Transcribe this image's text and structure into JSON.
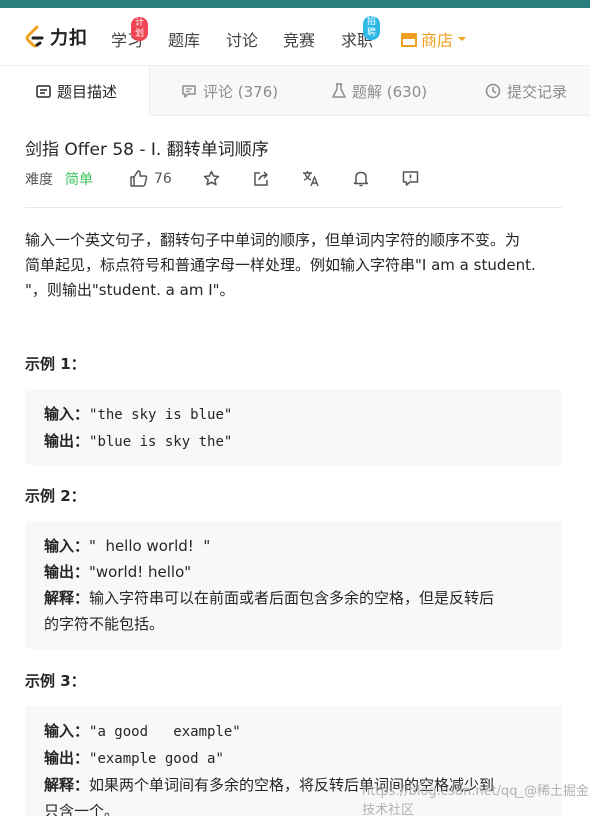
{
  "nav": {
    "logo_text": "力扣",
    "items": [
      {
        "label": "学习",
        "badge": "计划"
      },
      {
        "label": "题库"
      },
      {
        "label": "讨论"
      },
      {
        "label": "竞赛"
      },
      {
        "label": "求职",
        "badge": "招聘"
      },
      {
        "label": "商店"
      }
    ],
    "store_color": "#f0a020"
  },
  "tabs": [
    {
      "label": "题目描述",
      "icon": "description-icon",
      "active": true
    },
    {
      "label": "评论 (376)",
      "icon": "comment-icon"
    },
    {
      "label": "题解 (630)",
      "icon": "flask-icon"
    },
    {
      "label": "提交记录",
      "icon": "clock-icon"
    }
  ],
  "problem": {
    "title": "剑指 Offer 58 - I. 翻转单词顺序",
    "difficulty_label": "难度",
    "difficulty": "简单",
    "difficulty_color": "#3ec35d",
    "likes": "76",
    "description_lines": [
      "输入一个英文句子，翻转句子中单词的顺序，但单词内字符的顺序不变。为",
      "简单起见，标点符号和普通字母一样处理。例如输入字符串\"I am a student.",
      "\"，则输出\"student. a am I\"。"
    ]
  },
  "examples": [
    {
      "title": "示例 1：",
      "input_key": "输入：",
      "input": "\"the sky is blue\"",
      "output_key": "输出：",
      "output": "\"blue is sky the\""
    },
    {
      "title": "示例 2：",
      "input_key": "输入：",
      "input": "\"  hello world!  \"",
      "output_key": "输出：",
      "output": "\"world! hello\"",
      "explain_key": "解释：",
      "explain_1": "输入字符串可以在前面或者后面包含多余的空格，但是反转后",
      "explain_2": "的字符不能包括。"
    },
    {
      "title": "示例 3：",
      "input_key": "输入：",
      "input": "\"a good   example\"",
      "output_key": "输出：",
      "output": "\"example good a\"",
      "explain_key": "解释：",
      "explain_1": "如果两个单词间有多余的空格，将反转后单词间的空格减少到",
      "explain_2": "只含一个。"
    }
  ],
  "watermark": "https://blog.csdn.net/qq_@稀土掘金技术社区"
}
